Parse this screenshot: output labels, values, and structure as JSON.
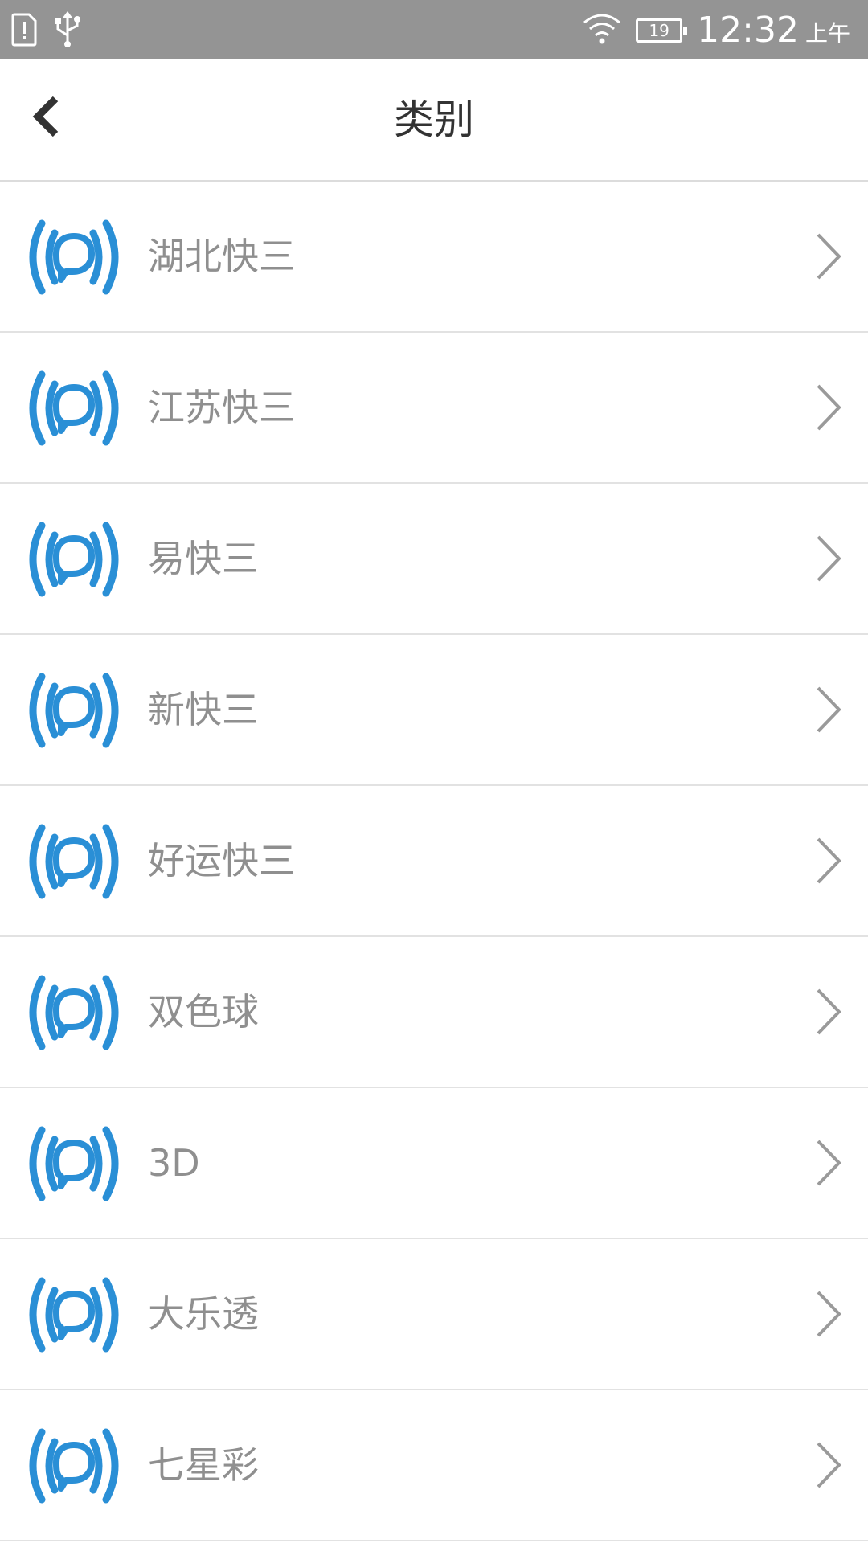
{
  "status_bar": {
    "time": "12:32",
    "ampm": "上午",
    "battery": "19",
    "icons": [
      "alert-icon",
      "usb-icon",
      "wifi-icon",
      "battery-icon"
    ]
  },
  "header": {
    "title": "类别",
    "back_icon": "back-arrow-icon"
  },
  "colors": {
    "accent": "#2a8fd6",
    "status_bar_bg": "#949494",
    "label_text": "#8f8f8f",
    "title_text": "#333333"
  },
  "list": {
    "row_icon": "broadcast-chat-icon",
    "items": [
      {
        "label": "湖北快三"
      },
      {
        "label": "江苏快三"
      },
      {
        "label": "易快三"
      },
      {
        "label": "新快三"
      },
      {
        "label": "好运快三"
      },
      {
        "label": "双色球"
      },
      {
        "label": "3D"
      },
      {
        "label": "大乐透"
      },
      {
        "label": "七星彩"
      }
    ]
  }
}
